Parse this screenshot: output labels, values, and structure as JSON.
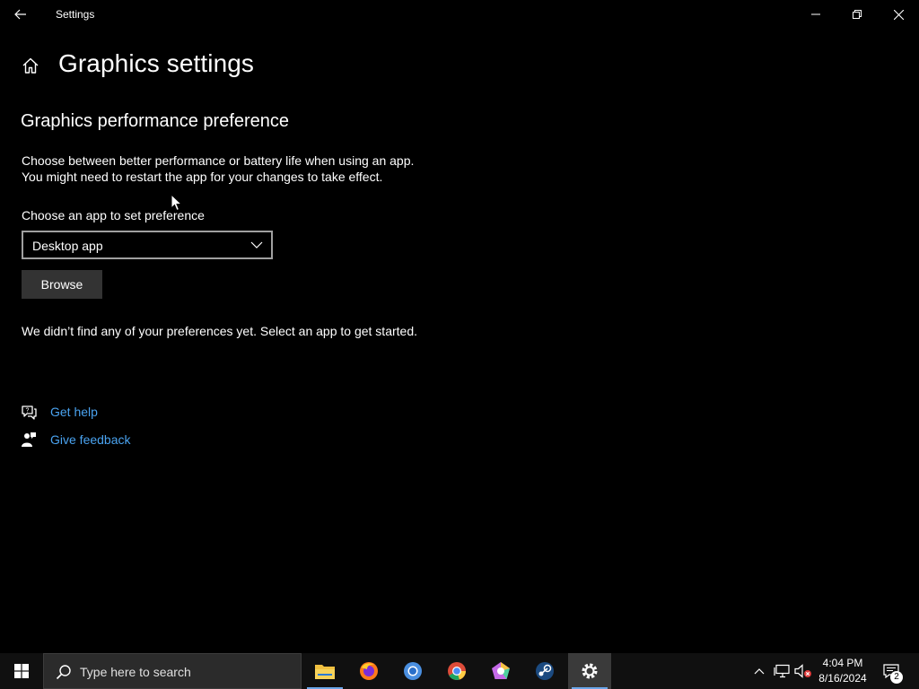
{
  "window": {
    "app_title": "Settings",
    "page_title": "Graphics settings"
  },
  "content": {
    "section_heading": "Graphics performance preference",
    "description_line1": "Choose between better performance or battery life when using an app.",
    "description_line2": "You might need to restart the app for your changes to take effect.",
    "choose_label": "Choose an app to set preference",
    "dropdown_value": "Desktop app",
    "browse_label": "Browse",
    "empty_message": "We didn’t find any of your preferences yet. Select an app to get started."
  },
  "help": {
    "get_help": "Get help",
    "give_feedback": "Give feedback"
  },
  "taskbar": {
    "search_placeholder": "Type here to search",
    "apps": [
      "file-explorer-icon",
      "firefox-icon",
      "chromium-icon",
      "chrome-icon",
      "pentagon-app-icon",
      "steam-icon",
      "settings-icon"
    ],
    "time": "4:04 PM",
    "date": "8/16/2024",
    "notification_count": "2"
  },
  "colors": {
    "background": "#000000",
    "link": "#4aa3f0",
    "taskbar": "#101010",
    "accent": "#6aa6e8"
  }
}
